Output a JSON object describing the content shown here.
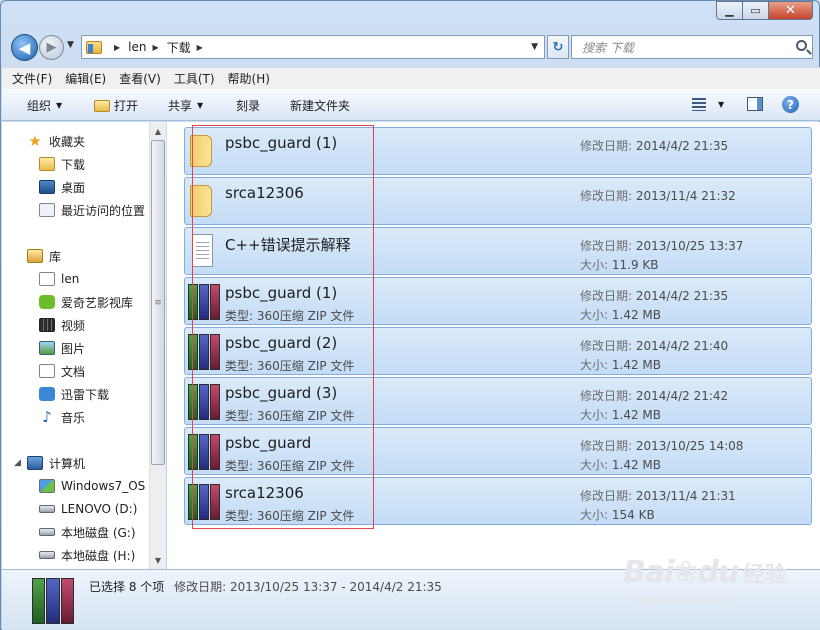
{
  "address": {
    "crumbs": [
      "len",
      "下载"
    ]
  },
  "search": {
    "placeholder": "搜索 下载"
  },
  "menu": [
    "文件(F)",
    "编辑(E)",
    "查看(V)",
    "工具(T)",
    "帮助(H)"
  ],
  "toolbar": {
    "organize": "组织",
    "open": "打开",
    "share": "共享",
    "burn": "刻录",
    "new_folder": "新建文件夹"
  },
  "nav": {
    "favorites": "收藏夹",
    "downloads": "下载",
    "desktop": "桌面",
    "recent": "最近访问的位置",
    "libraries": "库",
    "len": "len",
    "iqiyi": "爱奇艺影视库",
    "videos": "视频",
    "pictures": "图片",
    "documents": "文档",
    "xunlei": "迅雷下载",
    "music": "音乐",
    "computer": "计算机",
    "win7": "Windows7_OS (",
    "lenovo": "LENOVO (D:)",
    "disk_g": "本地磁盘 (G:)",
    "disk_h": "本地磁盘 (H:)"
  },
  "labels": {
    "modified": "修改日期:",
    "size": "大小:",
    "type": "类型:"
  },
  "files": [
    {
      "name": "psbc_guard (1)",
      "kind": "folder",
      "type": "",
      "modified": "2014/4/2 21:35",
      "size": ""
    },
    {
      "name": "srca12306",
      "kind": "folder",
      "type": "",
      "modified": "2013/11/4 21:32",
      "size": ""
    },
    {
      "name": "C++错误提示解释",
      "kind": "doc",
      "type": "",
      "modified": "2013/10/25 13:37",
      "size": "11.9 KB"
    },
    {
      "name": "psbc_guard (1)",
      "kind": "zip",
      "type": "360压缩 ZIP 文件",
      "modified": "2014/4/2 21:35",
      "size": "1.42 MB"
    },
    {
      "name": "psbc_guard (2)",
      "kind": "zip",
      "type": "360压缩 ZIP 文件",
      "modified": "2014/4/2 21:40",
      "size": "1.42 MB"
    },
    {
      "name": "psbc_guard (3)",
      "kind": "zip",
      "type": "360压缩 ZIP 文件",
      "modified": "2014/4/2 21:42",
      "size": "1.42 MB"
    },
    {
      "name": "psbc_guard",
      "kind": "zip",
      "type": "360压缩 ZIP 文件",
      "modified": "2013/10/25 14:08",
      "size": "1.42 MB"
    },
    {
      "name": "srca12306",
      "kind": "zip",
      "type": "360压缩 ZIP 文件",
      "modified": "2013/11/4 21:31",
      "size": "154 KB"
    }
  ],
  "details": {
    "selected": "已选择 8 个项",
    "modified_label": "修改日期:",
    "modified_range": "2013/10/25 13:37 - 2014/4/2 21:35"
  },
  "watermark": {
    "brand": "Bai",
    "brand2": "du",
    "cn": "经验",
    "url": "jingyan.baidu.com"
  }
}
